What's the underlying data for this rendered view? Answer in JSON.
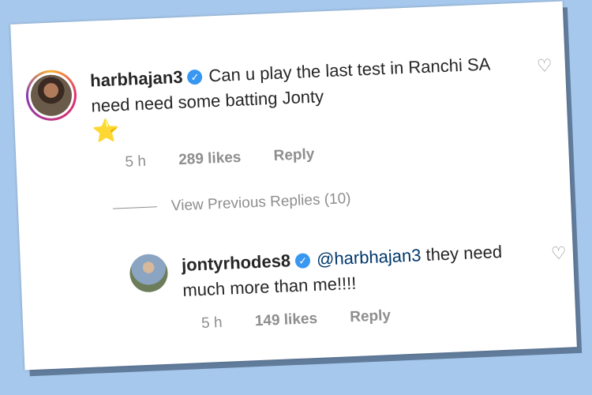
{
  "comment": {
    "username": "harbhajan3",
    "text": "Can u play the last test in Ranchi SA need  need some batting Jonty",
    "emoji": "⭐",
    "time": "5 h",
    "likes": "289 likes",
    "reply_label": "Reply",
    "heart_icon": "heart-icon"
  },
  "view_previous": "View Previous Replies (10)",
  "reply": {
    "username": "jontyrhodes8",
    "mention": "@harbhajan3",
    "text": "they need much more than me!!!!",
    "time": "5 h",
    "likes": "149 likes",
    "reply_label": "Reply",
    "heart_icon": "heart-icon"
  },
  "colors": {
    "background": "#a6c8ec",
    "verified": "#3897f0",
    "mention": "#00376b",
    "meta": "#8e8e8e"
  }
}
